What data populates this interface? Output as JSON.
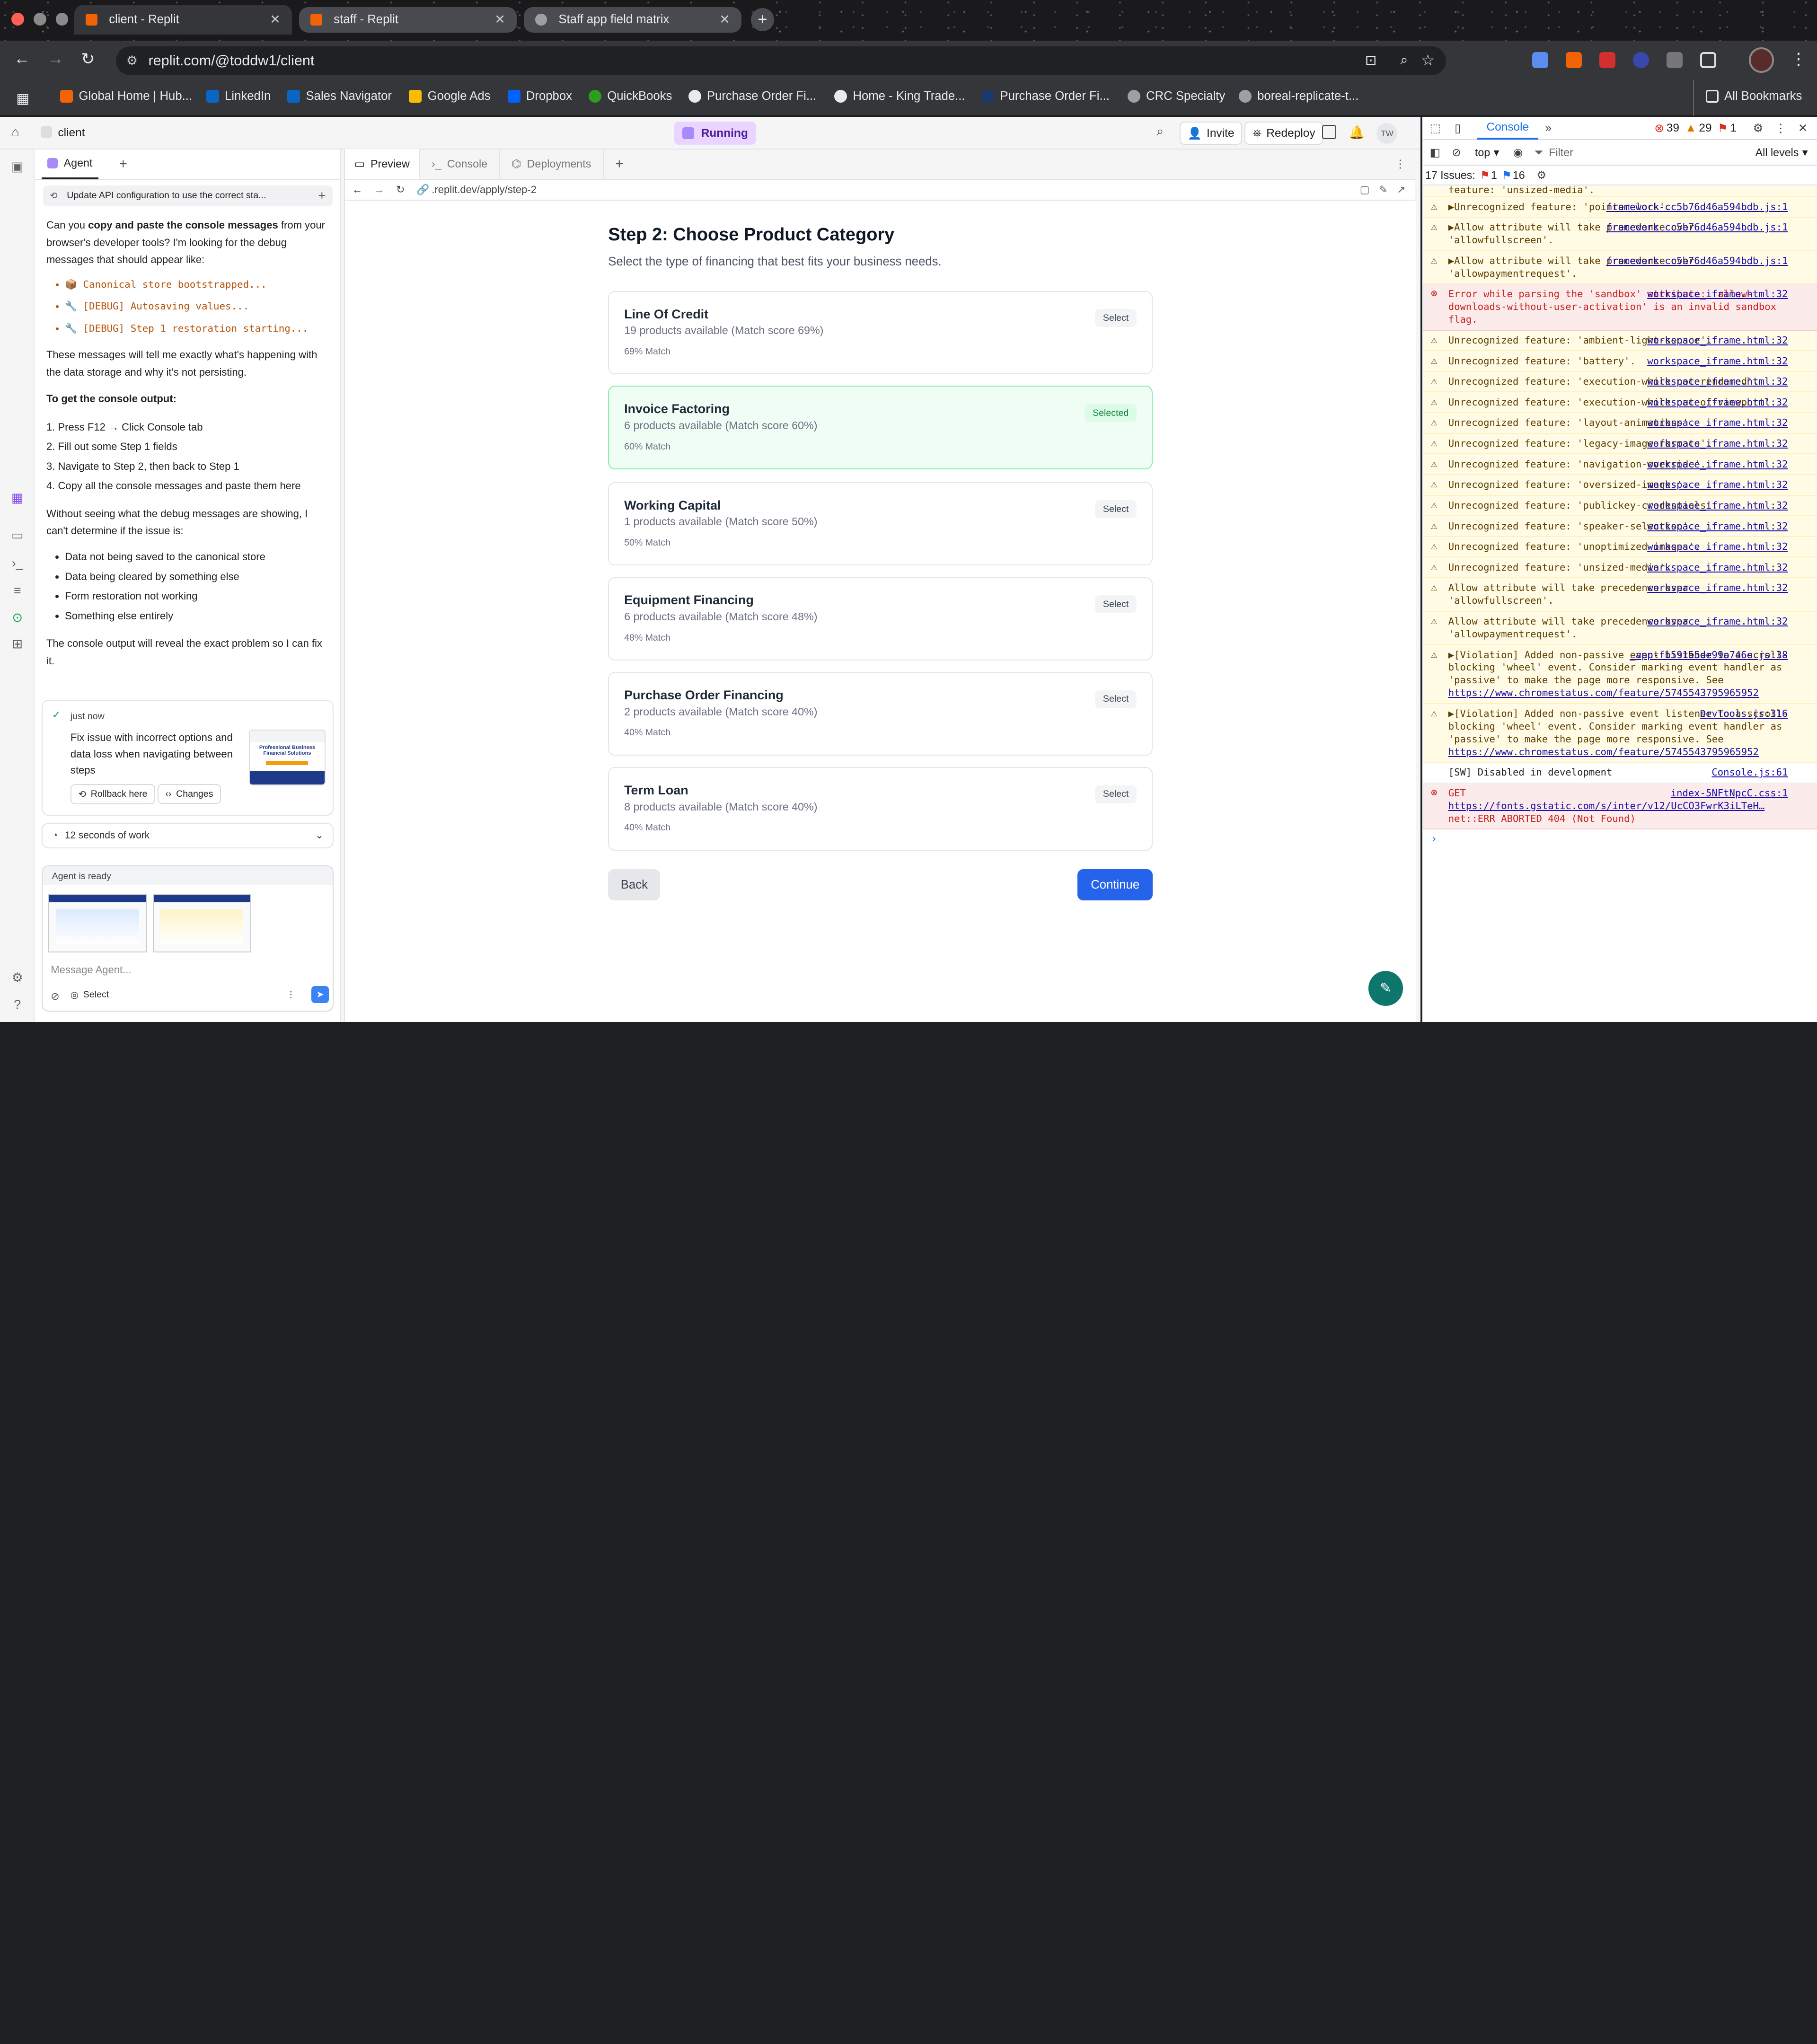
{
  "browser": {
    "tabs": [
      {
        "label": "client - Replit",
        "active": true
      },
      {
        "label": "staff - Replit",
        "active": false
      },
      {
        "label": "Staff app field matrix",
        "active": false
      }
    ],
    "url": "replit.com/@toddw1/client",
    "bookmarks": [
      "Global Home | Hub...",
      "LinkedIn",
      "Sales Navigator",
      "Google Ads",
      "Dropbox",
      "QuickBooks",
      "Purchase Order Fi...",
      "Home - King Trade...",
      "Purchase Order Fi...",
      "CRC Specialty",
      "boreal-replicate-t..."
    ],
    "all_bookmarks": "All Bookmarks"
  },
  "workspace": {
    "project_name": "client",
    "status": "Running",
    "invite_label": "Invite",
    "redeploy_label": "Redeploy",
    "avatar_initials": "TW"
  },
  "agent": {
    "tab_label": "Agent",
    "thread_title": "Update API configuration to use the correct sta...",
    "intro_pre": "Can you ",
    "intro_bold": "copy and paste the console messages",
    "intro_post": " from your browser's developer tools? I'm looking for the debug messages that should appear like:",
    "examples": [
      "📦 Canonical store bootstrapped...",
      "🔧 [DEBUG] Autosaving values...",
      "🔧 [DEBUG] Step 1 restoration starting..."
    ],
    "para2": "These messages will tell me exactly what's happening with the data storage and why it's not persisting.",
    "heading": "To get the console output:",
    "steps": [
      "1. Press F12 → Click Console tab",
      "2. Fill out some Step 1 fields",
      "3. Navigate to Step 2, then back to Step 1",
      "4. Copy all the console messages and paste them here"
    ],
    "para3": "Without seeing what the debug messages are showing, I can't determine if the issue is:",
    "issues": [
      "Data not being saved to the canonical store",
      "Data being cleared by something else",
      "Form restoration not working",
      "Something else entirely"
    ],
    "para4": "The console output will reveal the exact problem so I can fix it.",
    "checkpoint_time": "just now",
    "checkpoint_text": "Fix issue with incorrect options and data loss when navigating between steps",
    "thumb_text": "Professional Business Financial Solutions",
    "rollback_label": "Rollback here",
    "changes_label": "Changes",
    "work_label": "12 seconds of work",
    "ready_label": "Agent is ready",
    "input_placeholder": "Message Agent...",
    "select_label": "Select"
  },
  "preview": {
    "tabs": [
      "Preview",
      "Console",
      "Deployments"
    ],
    "path": ".replit.dev/apply/step-2",
    "title": "Step 2: Choose Product Category",
    "subtitle": "Select the type of financing that best fits your business needs.",
    "categories": [
      {
        "name": "Line Of Credit",
        "detail": "19 products available (Match score 69%)",
        "match": "69% Match",
        "button": "Select",
        "selected": false
      },
      {
        "name": "Invoice Factoring",
        "detail": "6 products available (Match score 60%)",
        "match": "60% Match",
        "button": "Selected",
        "selected": true
      },
      {
        "name": "Working Capital",
        "detail": "1 products available (Match score 50%)",
        "match": "50% Match",
        "button": "Select",
        "selected": false
      },
      {
        "name": "Equipment Financing",
        "detail": "6 products available (Match score 48%)",
        "match": "48% Match",
        "button": "Select",
        "selected": false
      },
      {
        "name": "Purchase Order Financing",
        "detail": "2 products available (Match score 40%)",
        "match": "40% Match",
        "button": "Select",
        "selected": false
      },
      {
        "name": "Term Loan",
        "detail": "8 products available (Match score 40%)",
        "match": "40% Match",
        "button": "Select",
        "selected": false
      }
    ],
    "back_label": "Back",
    "continue_label": "Continue"
  },
  "devtools": {
    "tab_console": "Console",
    "error_count": "39",
    "warn_count": "29",
    "issue_badge": "1",
    "context": "top",
    "filter_placeholder": "Filter",
    "levels": "All levels",
    "issues_label": "17 Issues:",
    "issues_err": "1",
    "issues_info": "16",
    "top_cut": "feature: 'unsized-media'.",
    "messages": [
      {
        "type": "warn",
        "text": "▶Unrecognized feature: 'pointer-lock'.",
        "source": "framework-cc5b76d46a594bdb.js:1"
      },
      {
        "type": "warn",
        "text": "▶Allow attribute will take precedence over 'allowfullscreen'.",
        "source": "framework-cc5b76d46a594bdb.js:1"
      },
      {
        "type": "warn",
        "text": "▶Allow attribute will take precedence over 'allowpaymentrequest'.",
        "source": "framework-cc5b76d46a594bdb.js:1"
      },
      {
        "type": "err",
        "text": "Error while parsing the 'sandbox' attribute: 'allow-downloads-without-user-activation' is an invalid sandbox flag.",
        "source": "workspace_iframe.html:32"
      },
      {
        "type": "warn",
        "text": "Unrecognized feature: 'ambient-light-sensor'.",
        "source": "workspace_iframe.html:32"
      },
      {
        "type": "warn",
        "text": "Unrecognized feature: 'battery'.",
        "source": "workspace_iframe.html:32"
      },
      {
        "type": "warn",
        "text": "Unrecognized feature: 'execution-while-not-rendered'.",
        "source": "workspace_iframe.html:32"
      },
      {
        "type": "warn",
        "text": "Unrecognized feature: 'execution-while-out-of-viewport'.",
        "source": "workspace_iframe.html:32"
      },
      {
        "type": "warn",
        "text": "Unrecognized feature: 'layout-animations'.",
        "source": "workspace_iframe.html:32"
      },
      {
        "type": "warn",
        "text": "Unrecognized feature: 'legacy-image-formats'.",
        "source": "workspace_iframe.html:32"
      },
      {
        "type": "warn",
        "text": "Unrecognized feature: 'navigation-override'.",
        "source": "workspace_iframe.html:32"
      },
      {
        "type": "warn",
        "text": "Unrecognized feature: 'oversized-images'.",
        "source": "workspace_iframe.html:32"
      },
      {
        "type": "warn",
        "text": "Unrecognized feature: 'publickey-credentials'.",
        "source": "workspace_iframe.html:32"
      },
      {
        "type": "warn",
        "text": "Unrecognized feature: 'speaker-selection'.",
        "source": "workspace_iframe.html:32"
      },
      {
        "type": "warn",
        "text": "Unrecognized feature: 'unoptimized-images'.",
        "source": "workspace_iframe.html:32"
      },
      {
        "type": "warn",
        "text": "Unrecognized feature: 'unsized-media'.",
        "source": "workspace_iframe.html:32"
      },
      {
        "type": "warn",
        "text": "Allow attribute will take precedence over 'allowfullscreen'.",
        "source": "workspace_iframe.html:32"
      },
      {
        "type": "warn",
        "text": "Allow attribute will take precedence over 'allowpaymentrequest'.",
        "source": "workspace_iframe.html:32"
      },
      {
        "type": "warn",
        "text": "▶[Violation] Added non-passive event listener to a scroll-blocking 'wheel' event. Consider marking event handler as 'passive' to make the page more responsive. See",
        "link": "https://www.chromestatus.com/feature/5745543795965952",
        "source": "_app-fb59155de99a746e.js:38"
      },
      {
        "type": "warn",
        "text": "▶[Violation] Added non-passive event listener to a scroll-blocking 'wheel' event. Consider marking event handler as 'passive' to make the page more responsive. See",
        "link": "https://www.chromestatus.com/feature/5745543795965952",
        "source": "DevTools.js:316"
      },
      {
        "type": "plain",
        "text": "[SW] Disabled in development",
        "source": "Console.js:61"
      },
      {
        "type": "err",
        "text": "GET",
        "link": "https://fonts.gstatic.com/s/inter/v12/UcCO3FwrK3iLTeH…",
        "tail": "net::ERR_ABORTED 404 (Not Found)",
        "source": "index-5NFtNpcC.css:1"
      }
    ]
  }
}
